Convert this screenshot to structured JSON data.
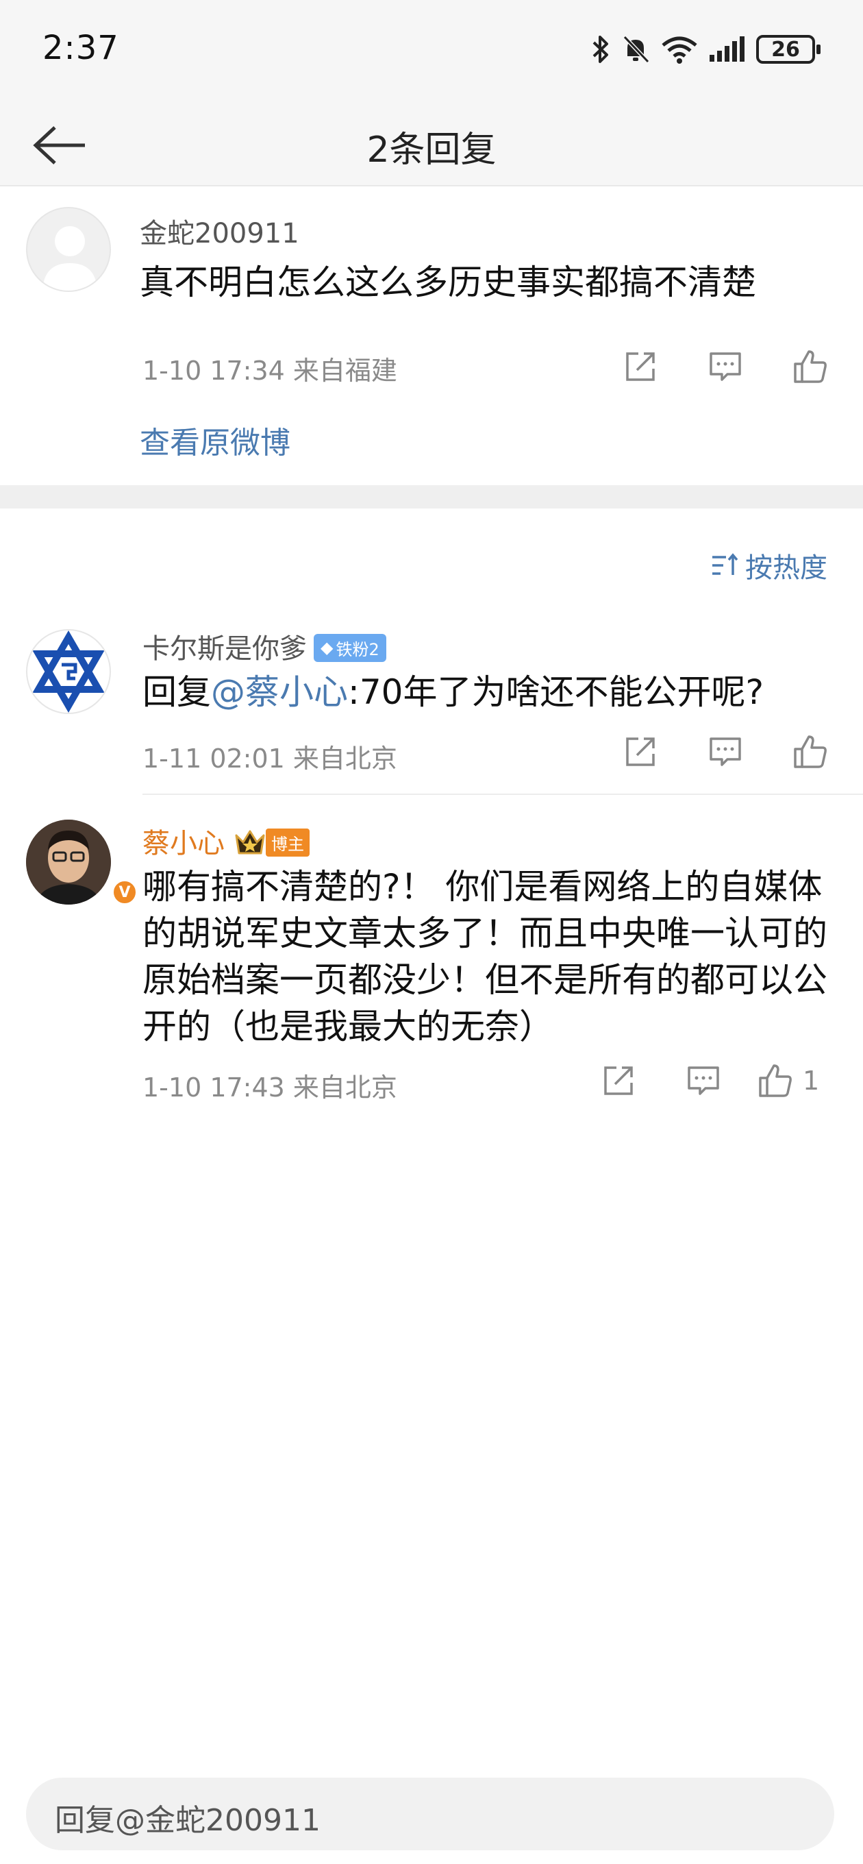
{
  "status_bar": {
    "time": "2:37",
    "battery": "26"
  },
  "header": {
    "title": "2条回复"
  },
  "original_comment": {
    "username": "金蛇200911",
    "text": "真不明白怎么这么多历史事实都搞不清楚",
    "meta": "1-10 17:34  来自福建",
    "view_original": "查看原微博"
  },
  "sort": {
    "label": "按热度"
  },
  "replies": [
    {
      "username": "卡尔斯是你爹",
      "badge": "铁粉2",
      "reply_prefix": "回复",
      "mention": "@蔡小心",
      "text": ":70年了为啥还不能公开呢?",
      "meta": "1-11 02:01  来自北京"
    },
    {
      "username": "蔡小心",
      "badge": "博主",
      "verified": "V",
      "text": "哪有搞不清楚的?！ 你们是看网络上的自媒体的胡说军史文章太多了！而且中央唯一认可的原始档案一页都没少！但不是所有的都可以公开的（也是我最大的无奈）",
      "meta": "1-10 17:43  来自北京",
      "like_count": "1"
    }
  ],
  "input": {
    "placeholder": "回复@金蛇200911"
  },
  "colors": {
    "link": "#4a7ab0",
    "author": "#e07a1f",
    "meta": "#8a8a8a"
  }
}
